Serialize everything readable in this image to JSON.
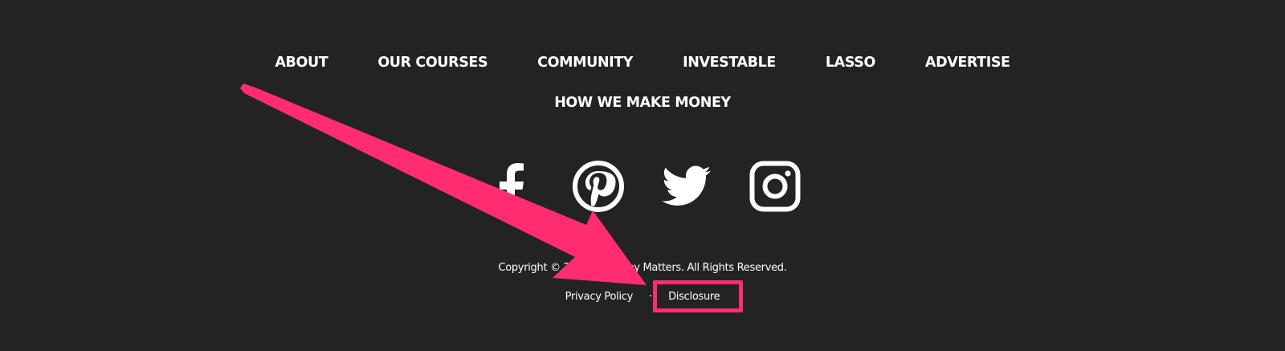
{
  "nav": {
    "items": [
      {
        "label": "ABOUT"
      },
      {
        "label": "OUR COURSES"
      },
      {
        "label": "COMMUNITY"
      },
      {
        "label": "INVESTABLE"
      },
      {
        "label": "LASSO"
      },
      {
        "label": "ADVERTISE"
      }
    ],
    "second_row": {
      "label": "HOW WE MAKE MONEY"
    }
  },
  "social": {
    "icons": [
      "facebook-icon",
      "pinterest-icon",
      "twitter-icon",
      "instagram-icon"
    ]
  },
  "footer": {
    "copyright_visible_start": "Copyright © 20",
    "copyright_visible_end": "ey Matters. All Rights Reserved.",
    "privacy_label": "Privacy Policy",
    "disclosure_label": "Disclosure"
  },
  "colors": {
    "background": "#232323",
    "text": "#ffffff",
    "annotation": "#ff2d6f"
  }
}
